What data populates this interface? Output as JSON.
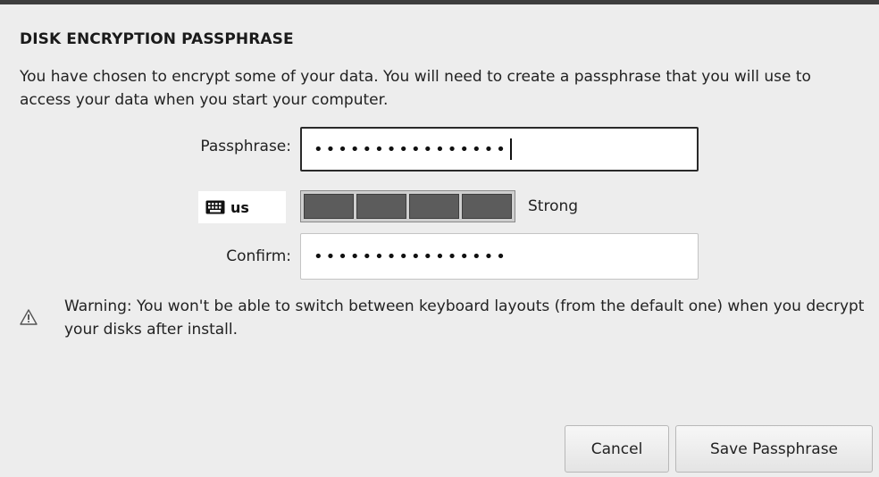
{
  "dialog": {
    "title": "DISK ENCRYPTION PASSPHRASE",
    "description": "You have chosen to encrypt some of your data. You will need to create a passphrase that you will use to access your data when you start your computer."
  },
  "passphrase": {
    "label": "Passphrase:",
    "value": "••••••••••••••••"
  },
  "keyboard": {
    "layout": "us",
    "icon": "keyboard-icon"
  },
  "strength": {
    "label": "Strong",
    "segments_filled": 4,
    "segments_total": 4
  },
  "confirm": {
    "label": "Confirm:",
    "value": "••••••••••••••••"
  },
  "warning": {
    "icon": "warning-icon",
    "text": "Warning: You won't be able to switch between keyboard layouts (from the default one) when you decrypt your disks after install."
  },
  "buttons": {
    "cancel": "Cancel",
    "save": "Save Passphrase"
  }
}
